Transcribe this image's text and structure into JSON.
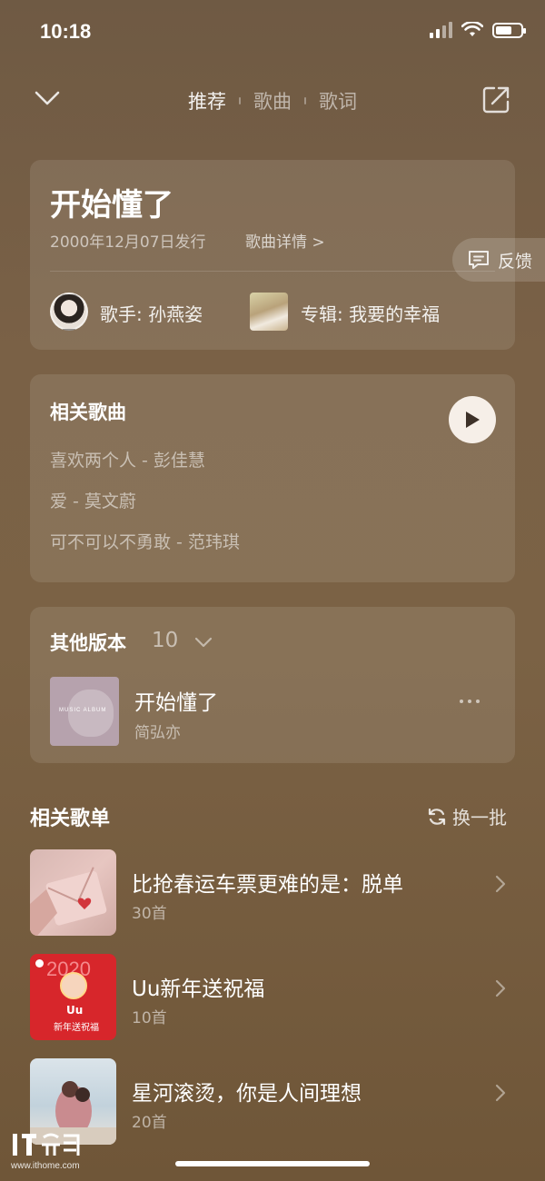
{
  "status_bar": {
    "time": "10:18"
  },
  "nav": {
    "tabs": [
      {
        "label": "推荐",
        "active": true
      },
      {
        "label": "歌曲",
        "active": false
      },
      {
        "label": "歌词",
        "active": false
      }
    ]
  },
  "song": {
    "title": "开始懂了",
    "release": "2000年12月07日发行",
    "details_link": "歌曲详情 >",
    "singer": "歌手: 孙燕姿",
    "album": "专辑: 我要的幸福"
  },
  "feedback": {
    "label": "反馈"
  },
  "related_songs": {
    "title": "相关歌曲",
    "items": [
      "喜欢两个人 - 彭佳慧",
      "爱 - 莫文蔚",
      "可不可以不勇敢 - 范玮琪"
    ]
  },
  "versions": {
    "title": "其他版本",
    "count": "10",
    "item": {
      "name": "开始懂了",
      "artist": "简弘亦",
      "thumb_text": "MUSIC ALBUM"
    }
  },
  "playlists": {
    "title": "相关歌单",
    "refresh_label": "换一批",
    "items": [
      {
        "name": "比抢春运车票更难的是：脱单",
        "count": "30首"
      },
      {
        "name": "Uu新年送祝福",
        "count": "10首",
        "thumb_year": "2020",
        "thumb_caption": "新年送祝福",
        "thumb_tag": "Uu"
      },
      {
        "name": "星河滚烫，你是人间理想",
        "count": "20首"
      }
    ]
  },
  "watermark": {
    "url": "www.ithome.com"
  },
  "colors": {
    "background": "#7a6146",
    "play_button": "#f6efe8"
  }
}
